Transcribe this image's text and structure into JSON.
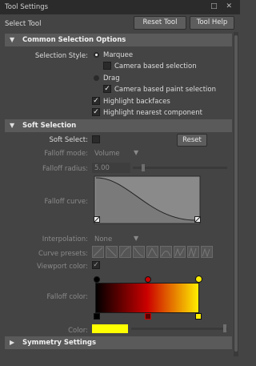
{
  "window": {
    "title": "Tool Settings",
    "icons": "□ ✕"
  },
  "header": {
    "tool_name": "Select Tool",
    "reset_tool": "Reset Tool",
    "tool_help": "Tool Help"
  },
  "common": {
    "title": "Common Selection Options",
    "selection_style_label": "Selection Style:",
    "marquee": "Marquee",
    "camera_based_selection": "Camera based selection",
    "drag": "Drag",
    "camera_based_paint": "Camera based paint selection",
    "highlight_backfaces": "Highlight backfaces",
    "highlight_nearest": "Highlight nearest component"
  },
  "soft": {
    "title": "Soft Selection",
    "soft_select_label": "Soft Select:",
    "reset": "Reset",
    "falloff_mode_label": "Falloff mode:",
    "falloff_mode_value": "Volume",
    "falloff_radius_label": "Falloff radius:",
    "falloff_radius_value": "5.00",
    "falloff_radius_fraction": 0.1,
    "falloff_curve_label": "Falloff curve:",
    "interpolation_label": "Interpolation:",
    "interpolation_value": "None",
    "curve_presets_label": "Curve presets:",
    "viewport_color_label": "Viewport color:",
    "falloff_color_label": "Falloff color:",
    "color_label": "Color:",
    "color_value": "#ffff00",
    "gradient_colors": [
      "#000000",
      "#cc0000",
      "#ffee00"
    ]
  },
  "symmetry": {
    "title": "Symmetry Settings"
  }
}
